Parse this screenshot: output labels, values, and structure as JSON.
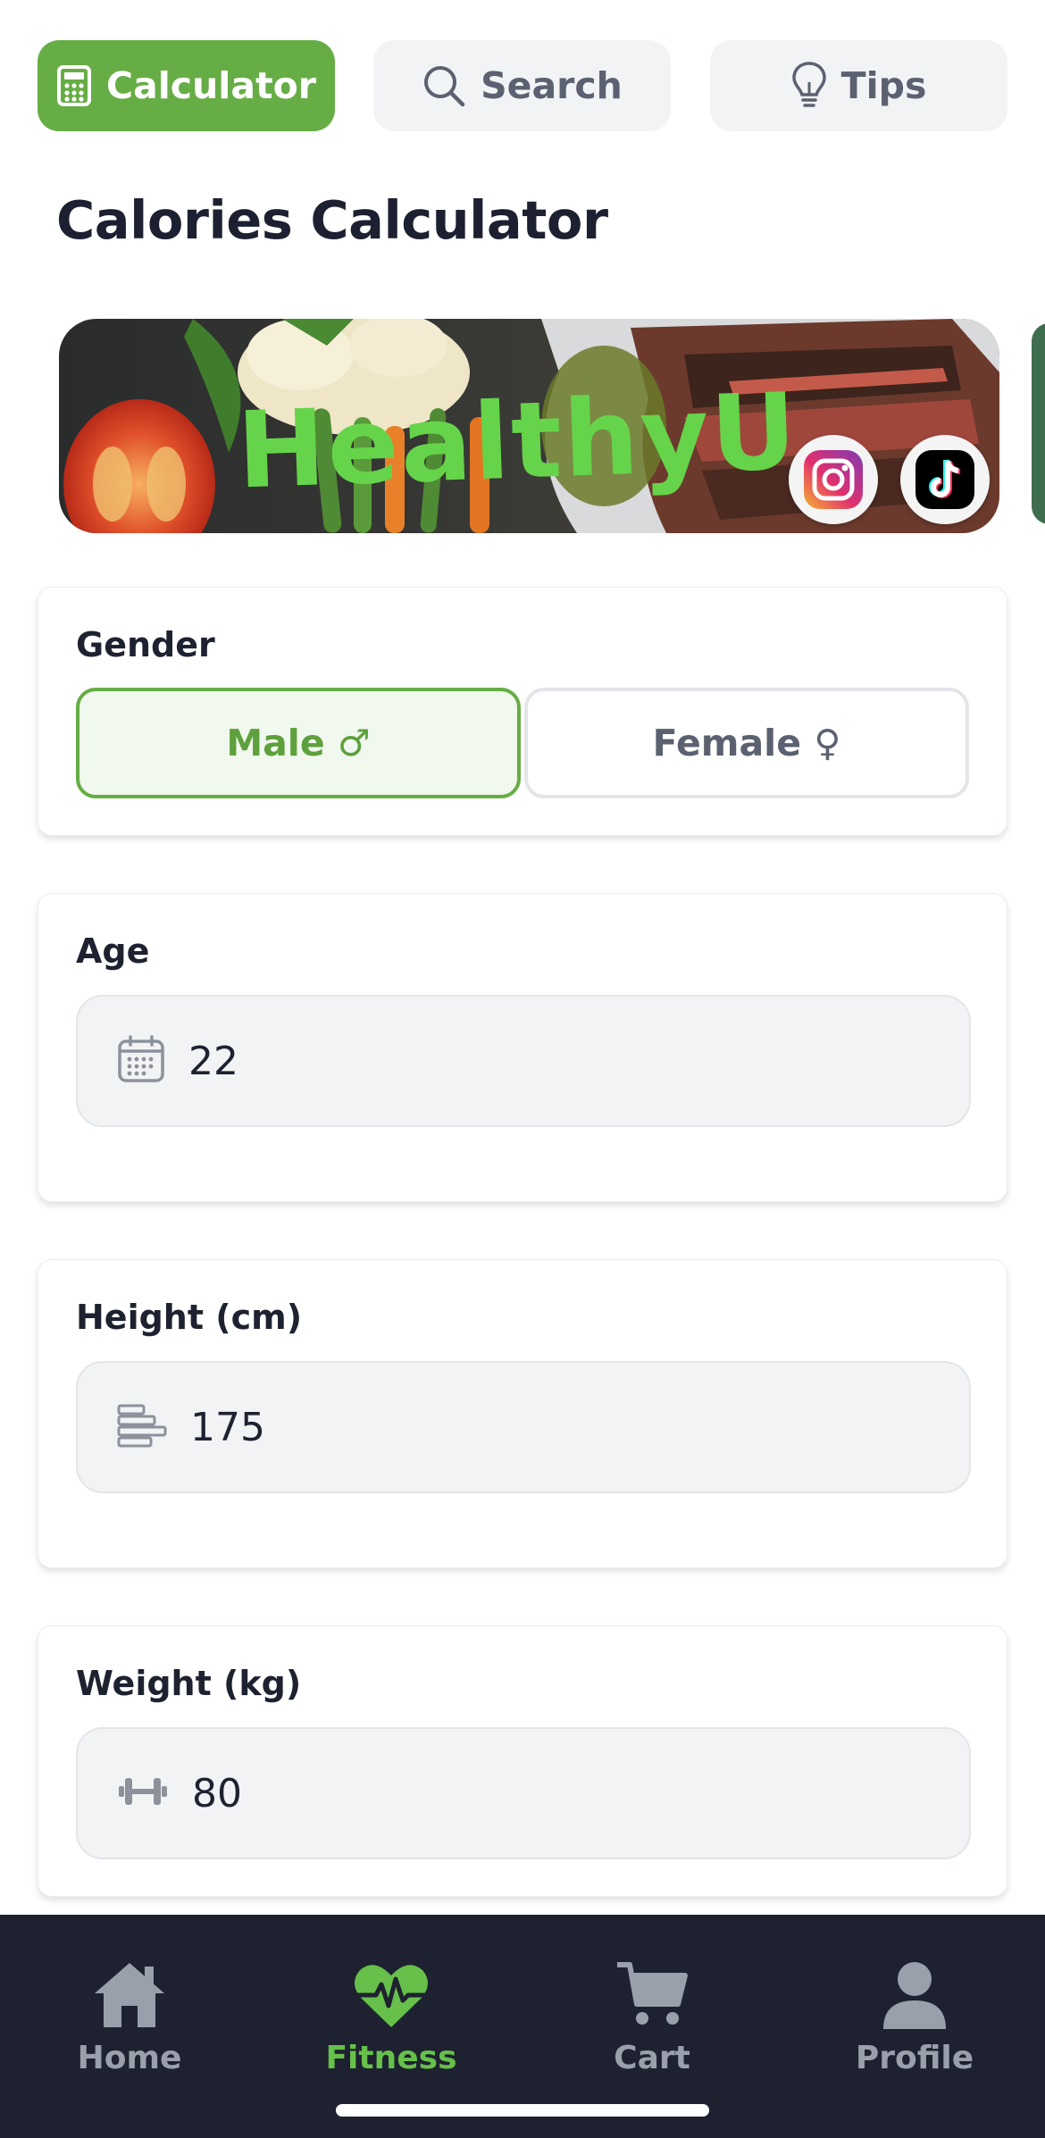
{
  "tabs": [
    {
      "label": "Calculator",
      "icon": "calculator-icon",
      "active": true
    },
    {
      "label": "Search",
      "icon": "search-icon",
      "active": false
    },
    {
      "label": "Tips",
      "icon": "lightbulb-icon",
      "active": false
    }
  ],
  "page_title": "Calories Calculator",
  "banner": {
    "brand_text": "HealthyU",
    "social": [
      "instagram-icon",
      "tiktok-icon"
    ]
  },
  "gender": {
    "label": "Gender",
    "options": [
      {
        "label": "Male ♂",
        "selected": true
      },
      {
        "label": "Female ♀",
        "selected": false
      }
    ]
  },
  "age": {
    "label": "Age",
    "value": "22",
    "icon": "calendar-icon"
  },
  "height": {
    "label": "Height (cm)",
    "value": "175",
    "icon": "ruler-icon"
  },
  "weight": {
    "label": "Weight (kg)",
    "value": "80",
    "icon": "dumbbell-icon"
  },
  "bottom_nav": [
    {
      "label": "Home",
      "icon": "home-icon",
      "active": false
    },
    {
      "label": "Fitness",
      "icon": "heartbeat-icon",
      "active": true
    },
    {
      "label": "Cart",
      "icon": "cart-icon",
      "active": false
    },
    {
      "label": "Profile",
      "icon": "profile-icon",
      "active": false
    }
  ],
  "colors": {
    "accent": "#66ad45",
    "nav_background": "#1e2230",
    "nav_active": "#66c04a",
    "inactive_text": "#5b6170",
    "field_background": "#f2f3f5"
  }
}
